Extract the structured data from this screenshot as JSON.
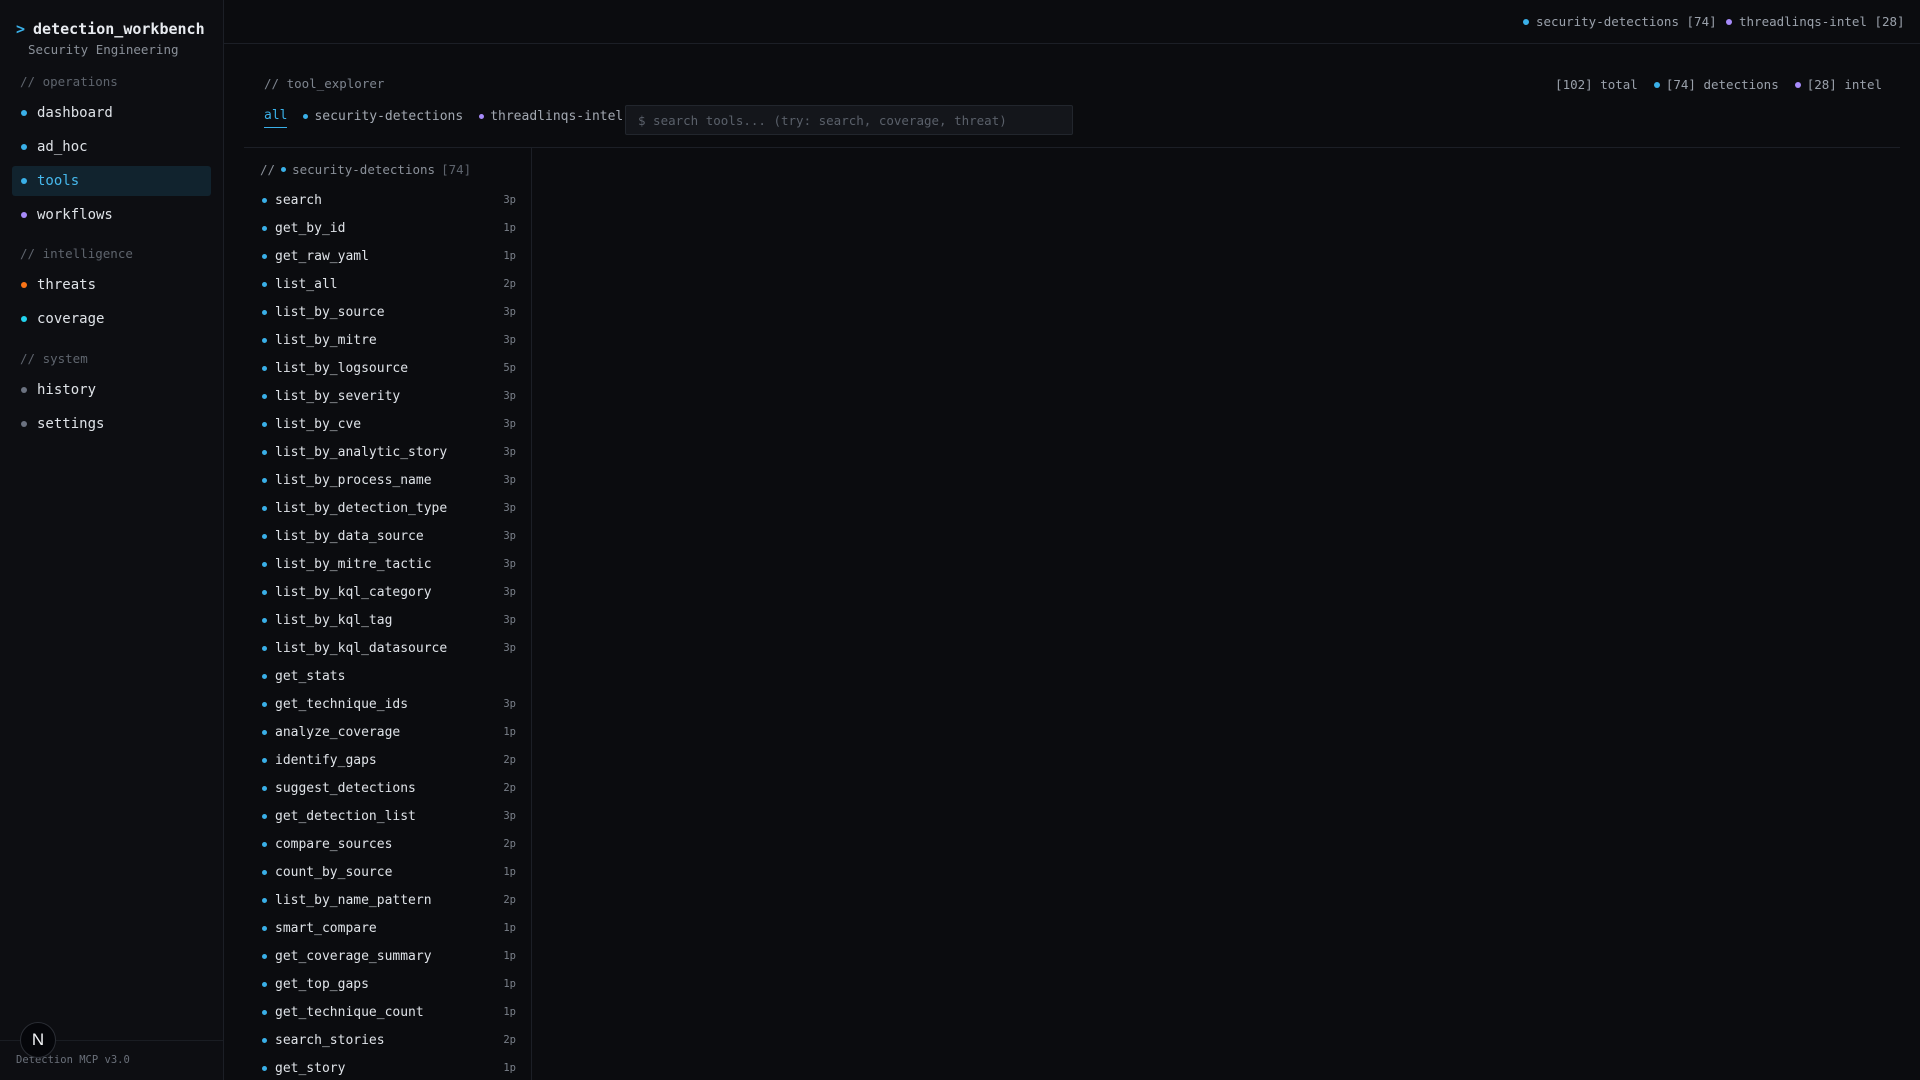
{
  "app": {
    "prompt": ">",
    "title": "detection_workbench",
    "subtitle": "Security Engineering",
    "version": "Detection MCP v3.0",
    "badge": "N"
  },
  "sidebar": {
    "sections": [
      {
        "header": "// operations",
        "items": [
          {
            "label": "dashboard",
            "color": "#3ab0e8",
            "active": false
          },
          {
            "label": "ad_hoc",
            "color": "#3ab0e8",
            "active": false
          },
          {
            "label": "tools",
            "color": "#3ab0e8",
            "active": true
          },
          {
            "label": "workflows",
            "color": "#a78bfa",
            "active": false
          }
        ]
      },
      {
        "header": "// intelligence",
        "items": [
          {
            "label": "threats",
            "color": "#f97316",
            "active": false
          },
          {
            "label": "coverage",
            "color": "#22d3ee",
            "active": false
          }
        ]
      },
      {
        "header": "// system",
        "items": [
          {
            "label": "history",
            "color": "#6b7280",
            "active": false
          },
          {
            "label": "settings",
            "color": "#6b7280",
            "active": false
          }
        ]
      }
    ]
  },
  "topbar": {
    "sources": [
      {
        "label": "security-detections [74]",
        "color": "#3ab0e8"
      },
      {
        "label": "threadlinqs-intel [28]",
        "color": "#a78bfa"
      }
    ]
  },
  "explorer": {
    "crumb": "// tool_explorer",
    "stats": {
      "total": "[102] total",
      "detections": "[74] detections",
      "intel": "[28] intel"
    },
    "tabs": [
      {
        "label": "all",
        "active": true
      },
      {
        "label": "security-detections",
        "color": "#3ab0e8",
        "active": false
      },
      {
        "label": "threadlinqs-intel",
        "color": "#a78bfa",
        "active": false
      }
    ],
    "search_placeholder": "$ search tools... (try: search, coverage, threat)"
  },
  "toollist": {
    "prefix": "//",
    "group": "security-detections",
    "count": "[74]",
    "tools": [
      {
        "name": "search",
        "params": "3p"
      },
      {
        "name": "get_by_id",
        "params": "1p"
      },
      {
        "name": "get_raw_yaml",
        "params": "1p"
      },
      {
        "name": "list_all",
        "params": "2p"
      },
      {
        "name": "list_by_source",
        "params": "3p"
      },
      {
        "name": "list_by_mitre",
        "params": "3p"
      },
      {
        "name": "list_by_logsource",
        "params": "5p"
      },
      {
        "name": "list_by_severity",
        "params": "3p"
      },
      {
        "name": "list_by_cve",
        "params": "3p"
      },
      {
        "name": "list_by_analytic_story",
        "params": "3p"
      },
      {
        "name": "list_by_process_name",
        "params": "3p"
      },
      {
        "name": "list_by_detection_type",
        "params": "3p"
      },
      {
        "name": "list_by_data_source",
        "params": "3p"
      },
      {
        "name": "list_by_mitre_tactic",
        "params": "3p"
      },
      {
        "name": "list_by_kql_category",
        "params": "3p"
      },
      {
        "name": "list_by_kql_tag",
        "params": "3p"
      },
      {
        "name": "list_by_kql_datasource",
        "params": "3p"
      },
      {
        "name": "get_stats",
        "params": ""
      },
      {
        "name": "get_technique_ids",
        "params": "3p"
      },
      {
        "name": "analyze_coverage",
        "params": "1p"
      },
      {
        "name": "identify_gaps",
        "params": "2p"
      },
      {
        "name": "suggest_detections",
        "params": "2p"
      },
      {
        "name": "get_detection_list",
        "params": "3p"
      },
      {
        "name": "compare_sources",
        "params": "2p"
      },
      {
        "name": "count_by_source",
        "params": "1p"
      },
      {
        "name": "list_by_name_pattern",
        "params": "2p"
      },
      {
        "name": "smart_compare",
        "params": "1p"
      },
      {
        "name": "get_coverage_summary",
        "params": "1p"
      },
      {
        "name": "get_top_gaps",
        "params": "1p"
      },
      {
        "name": "get_technique_count",
        "params": "1p"
      },
      {
        "name": "search_stories",
        "params": "2p"
      },
      {
        "name": "get_story",
        "params": "1p"
      }
    ]
  }
}
